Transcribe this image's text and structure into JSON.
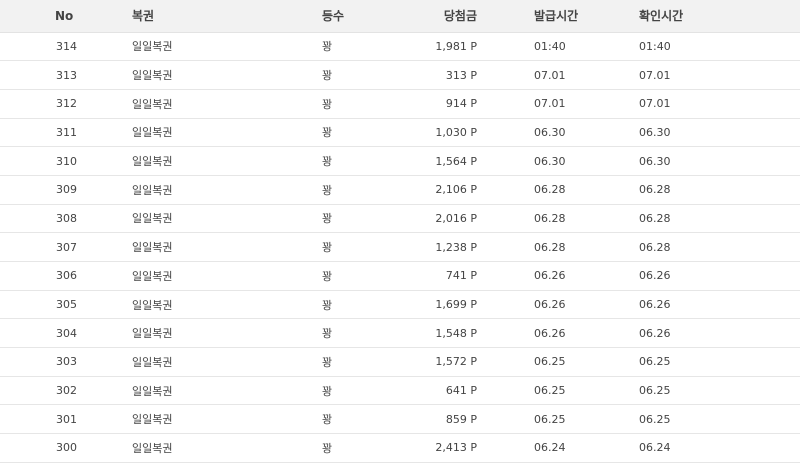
{
  "table": {
    "headers": {
      "no": "No",
      "name": "복권",
      "rank": "등수",
      "prize": "당첨금",
      "issued": "발급시간",
      "checked": "확인시간"
    },
    "rows": [
      {
        "no": "314",
        "name": "일일복권",
        "rank": "꽝",
        "prize": "1,981 P",
        "issued": "01:40",
        "checked": "01:40"
      },
      {
        "no": "313",
        "name": "일일복권",
        "rank": "꽝",
        "prize": "313 P",
        "issued": "07.01",
        "checked": "07.01"
      },
      {
        "no": "312",
        "name": "일일복권",
        "rank": "꽝",
        "prize": "914 P",
        "issued": "07.01",
        "checked": "07.01"
      },
      {
        "no": "311",
        "name": "일일복권",
        "rank": "꽝",
        "prize": "1,030 P",
        "issued": "06.30",
        "checked": "06.30"
      },
      {
        "no": "310",
        "name": "일일복권",
        "rank": "꽝",
        "prize": "1,564 P",
        "issued": "06.30",
        "checked": "06.30"
      },
      {
        "no": "309",
        "name": "일일복권",
        "rank": "꽝",
        "prize": "2,106 P",
        "issued": "06.28",
        "checked": "06.28"
      },
      {
        "no": "308",
        "name": "일일복권",
        "rank": "꽝",
        "prize": "2,016 P",
        "issued": "06.28",
        "checked": "06.28"
      },
      {
        "no": "307",
        "name": "일일복권",
        "rank": "꽝",
        "prize": "1,238 P",
        "issued": "06.28",
        "checked": "06.28"
      },
      {
        "no": "306",
        "name": "일일복권",
        "rank": "꽝",
        "prize": "741 P",
        "issued": "06.26",
        "checked": "06.26"
      },
      {
        "no": "305",
        "name": "일일복권",
        "rank": "꽝",
        "prize": "1,699 P",
        "issued": "06.26",
        "checked": "06.26"
      },
      {
        "no": "304",
        "name": "일일복권",
        "rank": "꽝",
        "prize": "1,548 P",
        "issued": "06.26",
        "checked": "06.26"
      },
      {
        "no": "303",
        "name": "일일복권",
        "rank": "꽝",
        "prize": "1,572 P",
        "issued": "06.25",
        "checked": "06.25"
      },
      {
        "no": "302",
        "name": "일일복권",
        "rank": "꽝",
        "prize": "641 P",
        "issued": "06.25",
        "checked": "06.25"
      },
      {
        "no": "301",
        "name": "일일복권",
        "rank": "꽝",
        "prize": "859 P",
        "issued": "06.25",
        "checked": "06.25"
      },
      {
        "no": "300",
        "name": "일일복권",
        "rank": "꽝",
        "prize": "2,413 P",
        "issued": "06.24",
        "checked": "06.24"
      }
    ]
  }
}
